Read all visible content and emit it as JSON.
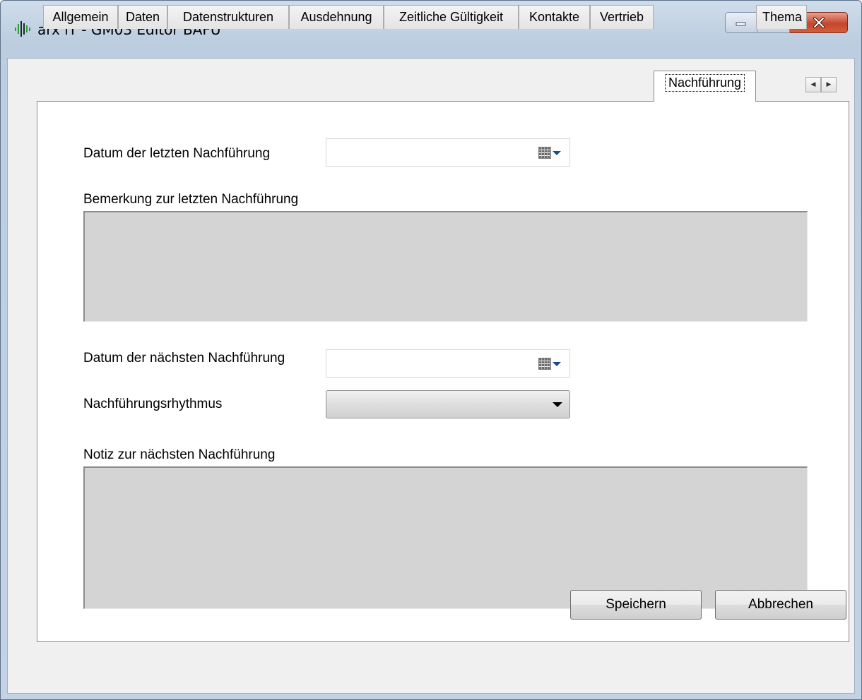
{
  "window": {
    "title": "arx iT - GM03 Editor BAFU"
  },
  "tabs": [
    {
      "label": "Allgemein"
    },
    {
      "label": "Daten"
    },
    {
      "label": "Datenstrukturen"
    },
    {
      "label": "Ausdehnung"
    },
    {
      "label": "Zeitliche Gültigkeit"
    },
    {
      "label": "Kontakte"
    },
    {
      "label": "Vertrieb"
    },
    {
      "label": "Nachführung",
      "active": true
    },
    {
      "label": "Thema"
    }
  ],
  "form": {
    "last_update_date_label": "Datum der letzten Nachführung",
    "last_update_date_value": "",
    "last_update_remark_label": "Bemerkung zur letzten Nachführung",
    "last_update_remark_value": "",
    "next_update_date_label": "Datum der nächsten Nachführung",
    "next_update_date_value": "",
    "update_rhythm_label": "Nachführungsrhythmus",
    "update_rhythm_value": "",
    "next_update_note_label": "Notiz zur nächsten Nachführung",
    "next_update_note_value": ""
  },
  "buttons": {
    "save": "Speichern",
    "cancel": "Abbrechen"
  },
  "icons": {
    "app": "arx-it-logo-icon",
    "calendar": "calendar-icon",
    "dropdown": "chevron-down-icon"
  },
  "colors": {
    "app_icon_green": "#2e9a3b",
    "close_red": "#c7462b",
    "readonly_field": "#d4d4d4"
  }
}
